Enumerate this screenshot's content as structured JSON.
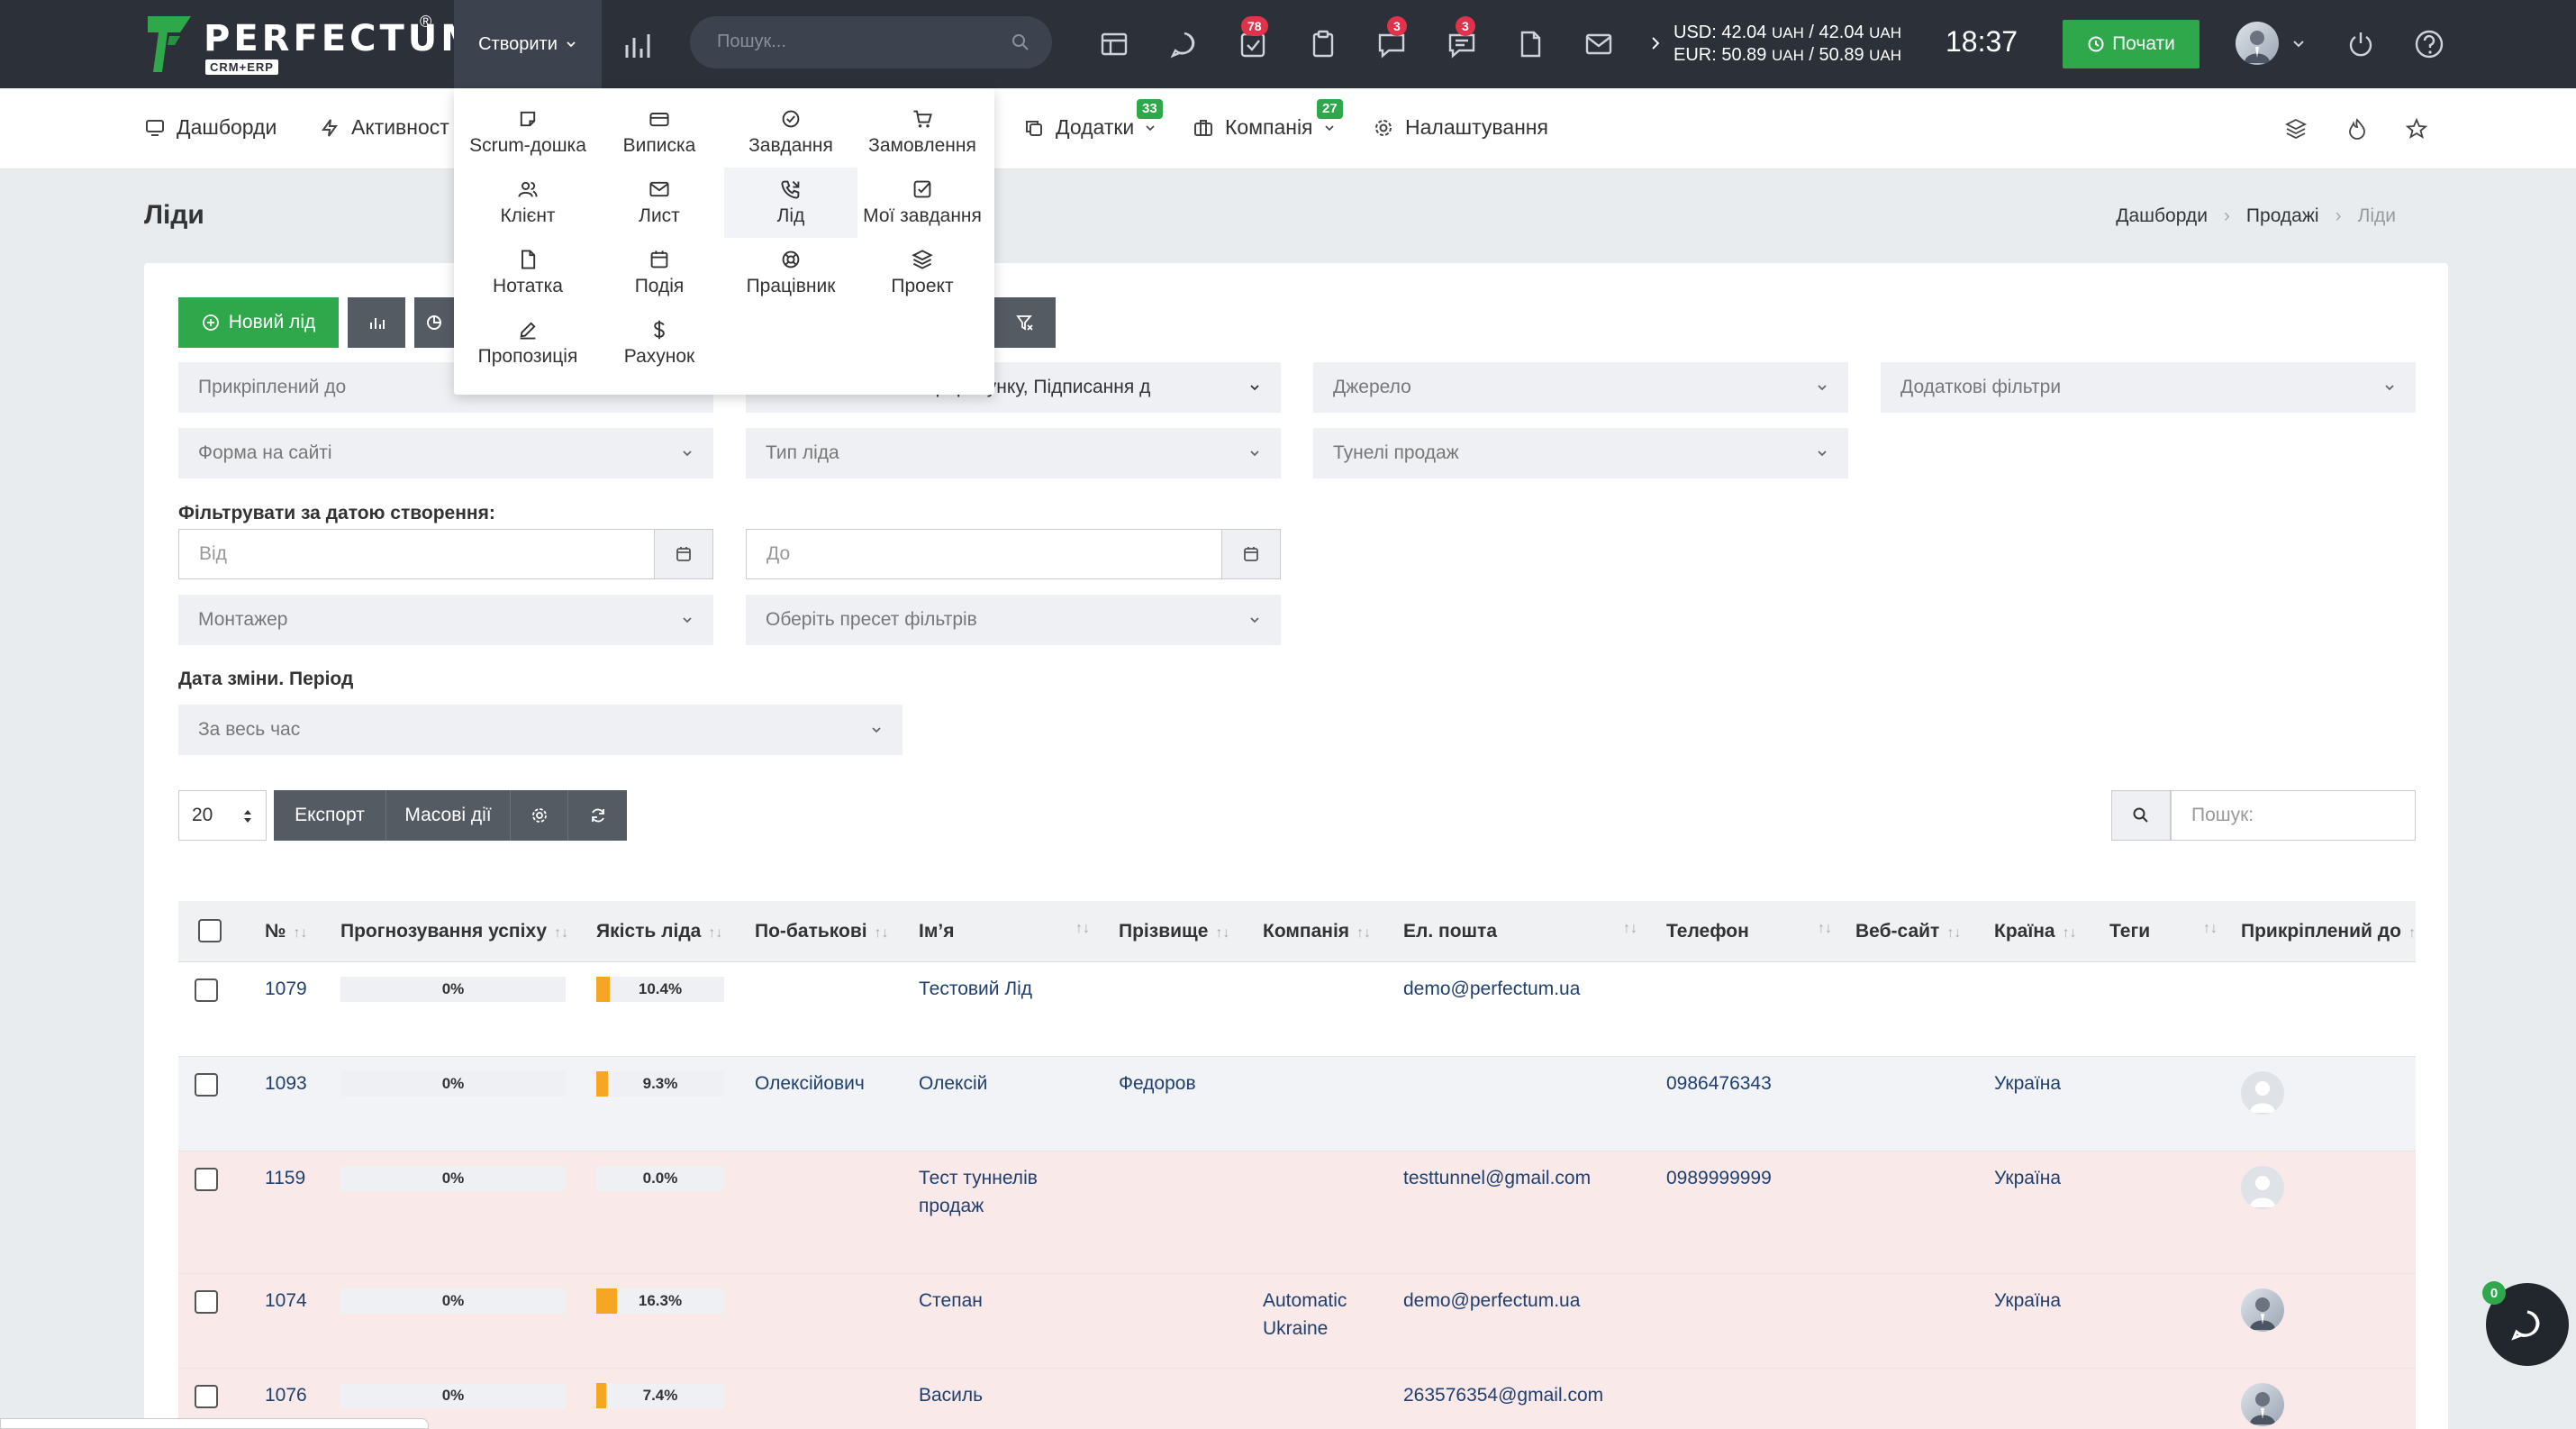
{
  "brand": {
    "name": "PERFECTUM",
    "reg": "®",
    "sub": "CRM+ERP",
    "mark_color": "#2ea84a"
  },
  "topbar": {
    "create_label": "Створити",
    "search_placeholder": "Пошук...",
    "badges": {
      "tasks": "78",
      "chat": "3",
      "messages": "3"
    },
    "usd": "USD: 42.04",
    "usd_unit1": "UAH",
    "usd_sep": " / 42.04 ",
    "usd_unit2": "UAH",
    "eur": "EUR: 50.89",
    "eur_unit1": "UAH",
    "eur_sep": " / 50.89 ",
    "eur_unit2": "UAH",
    "time": "18:37",
    "start_label": "Почати"
  },
  "nav": {
    "dashboards": "Дашборди",
    "activity": "Активност",
    "addons": "Додатки",
    "addons_badge": "33",
    "company": "Компанія",
    "company_badge": "27",
    "settings": "Налаштування"
  },
  "create_menu": [
    {
      "label": "Scrum-дошка",
      "icon": "board-icon"
    },
    {
      "label": "Виписка",
      "icon": "card-icon"
    },
    {
      "label": "Завдання",
      "icon": "check-circle-icon"
    },
    {
      "label": "Замовлення",
      "icon": "cart-icon"
    },
    {
      "label": "Клієнт",
      "icon": "users-icon"
    },
    {
      "label": "Лист",
      "icon": "mail-icon"
    },
    {
      "label": "Лід",
      "icon": "phone-icon"
    },
    {
      "label": "Мої завдання",
      "icon": "checkbox-icon"
    },
    {
      "label": "Нотатка",
      "icon": "note-icon"
    },
    {
      "label": "Подія",
      "icon": "calendar-icon"
    },
    {
      "label": "Працівник",
      "icon": "lifebuoy-icon"
    },
    {
      "label": "Проект",
      "icon": "layers-icon"
    },
    {
      "label": "Пропозиція",
      "icon": "pen-icon"
    },
    {
      "label": "Рахунок",
      "icon": "dollar-icon"
    }
  ],
  "page": {
    "title": "Ліди",
    "crumbs": [
      "Дашборди",
      "Продажі",
      "Ліди"
    ]
  },
  "toolbar": {
    "new_lead": "Новий лід"
  },
  "filters": {
    "attached_to": "Прикріплений до",
    "status_value": "я прорахунку, Підписання д",
    "source": "Джерело",
    "extra": "Додаткові фільтри",
    "site_form": "Форма на сайті",
    "lead_type": "Тип ліда",
    "tunnels": "Тунелі продаж",
    "date_label": "Фільтрувати за датою створення:",
    "from": "Від",
    "to": "До",
    "installer": "Монтажер",
    "preset": "Оберіть пресет фільтрів",
    "change_label": "Дата зміни. Період",
    "period": "За весь час"
  },
  "list_controls": {
    "page_size": "20",
    "export": "Експорт",
    "bulk": "Масові дії",
    "search_placeholder": "Пошук:"
  },
  "columns": [
    "№",
    "Прогнозування успіху",
    "Якість ліда",
    "По-батькові",
    "Ім’я",
    "Прізвище",
    "Компанія",
    "Ел. пошта",
    "Телефон",
    "Веб-сайт",
    "Країна",
    "Теги",
    "Прикріплений до"
  ],
  "rows": [
    {
      "id": "1079",
      "forecast": "0%",
      "quality": "10.4%",
      "quality_value": 0.104,
      "patronymic": "",
      "name": "Тестовий Лід",
      "surname": "",
      "company": "",
      "email": "demo@perfectum.ua",
      "phone": "",
      "country": "",
      "avatar": "none",
      "bg": "#ffffff"
    },
    {
      "id": "1093",
      "forecast": "0%",
      "quality": "9.3%",
      "quality_value": 0.093,
      "patronymic": "Олексійович",
      "name": "Олексій",
      "surname": "Федоров",
      "company": "",
      "email": "",
      "phone": "0986476343",
      "country": "Україна",
      "avatar": "placeholder",
      "bg": "#f1f3f6"
    },
    {
      "id": "1159",
      "forecast": "0%",
      "quality": "0.0%",
      "quality_value": 0,
      "patronymic": "",
      "name": "Тест туннелів продаж",
      "surname": "",
      "company": "",
      "email": "testtunnel@gmail.com",
      "phone": "0989999999",
      "country": "Україна",
      "avatar": "placeholder",
      "bg": "#f9e9e8"
    },
    {
      "id": "1074",
      "forecast": "0%",
      "quality": "16.3%",
      "quality_value": 0.163,
      "patronymic": "",
      "name": "Степан",
      "surname": "",
      "company": "Automatic Ukraine",
      "email": "demo@perfectum.ua",
      "phone": "",
      "country": "Україна",
      "avatar": "photo",
      "bg": "#f9e9e8"
    },
    {
      "id": "1076",
      "forecast": "0%",
      "quality": "7.4%",
      "quality_value": 0.074,
      "patronymic": "",
      "name": "Василь",
      "surname": "",
      "company": "",
      "email": "263576354@gmail.com",
      "phone": "",
      "country": "",
      "avatar": "photo",
      "bg": "#f9e9e8"
    }
  ],
  "chat": {
    "count": "0"
  }
}
